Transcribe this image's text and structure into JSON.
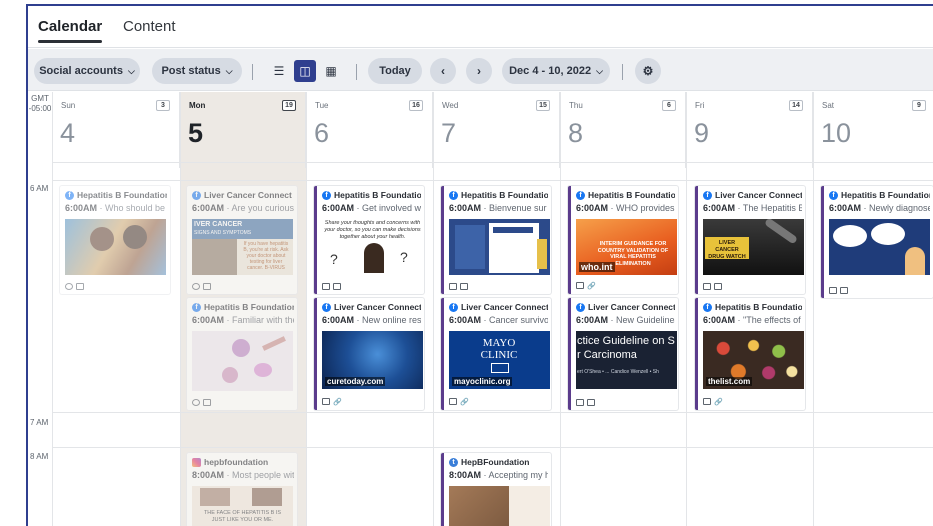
{
  "tabs": [
    {
      "label": "Calendar",
      "active": true
    },
    {
      "label": "Content",
      "active": false
    }
  ],
  "toolbar": {
    "social_accounts": "Social accounts",
    "post_status": "Post status",
    "today": "Today",
    "date_range": "Dec 4 - 10, 2022"
  },
  "timezone": {
    "line1": "GMT",
    "line2": "-05:00"
  },
  "days": [
    {
      "name": "Sun",
      "number": "4",
      "count": "3"
    },
    {
      "name": "Mon",
      "number": "5",
      "count": "19"
    },
    {
      "name": "Tue",
      "number": "6",
      "count": "16"
    },
    {
      "name": "Wed",
      "number": "7",
      "count": "15"
    },
    {
      "name": "Thu",
      "number": "8",
      "count": "6"
    },
    {
      "name": "Fri",
      "number": "9",
      "count": "14"
    },
    {
      "name": "Sat",
      "number": "10",
      "count": "9"
    }
  ],
  "time_labels": [
    "6 AM",
    "7 AM",
    "8 AM"
  ],
  "posts": {
    "sun_6a": {
      "account": "Hepatitis B Foundation",
      "time": "6:00AM",
      "text": " · Who should be vaccinated"
    },
    "mon_6a": {
      "account": "Liver Cancer Connect",
      "time": "6:00AM",
      "text": " · Are you curious",
      "thumb_title": "IVER CANCER",
      "thumb_sub": "SIGNS AND SYMPTOMS",
      "thumb_body": "If you have hepatitis B, you're at risk. Ask your doctor about testing for liver cancer. B-VIRUS"
    },
    "mon_6b": {
      "account": "Hepatitis B Foundation",
      "time": "6:00AM",
      "text": " · Familiar with the"
    },
    "mon_8a": {
      "account": "hepbfoundation",
      "time": "8:00AM",
      "text": " · Most people with",
      "thumb_caption": "THE FACE OF HEPATITIS B IS JUST LIKE YOU OR ME."
    },
    "tue_6a": {
      "account": "Hepatitis B Foundation",
      "time": "6:00AM",
      "text": " · Get involved with",
      "thumb_body": "Share your thoughts and concerns with your doctor, so you can make decisions together about your health."
    },
    "tue_6b": {
      "account": "Liver Cancer Connect",
      "time": "6:00AM",
      "text": " · New online resource",
      "thumb_tag": "curetoday.com"
    },
    "wed_6a": {
      "account": "Hepatitis B Foundation",
      "time": "6:00AM",
      "text": " · Bienvenue sur le"
    },
    "wed_6b": {
      "account": "Liver Cancer Connect",
      "time": "6:00AM",
      "text": " · Cancer survivors",
      "thumb_brand": "MAYO CLINIC",
      "thumb_tag": "mayoclinic.org"
    },
    "wed_8a": {
      "account": "HepBFoundation",
      "time": "8:00AM",
      "text": " · Accepting my hepatitis"
    },
    "thu_6a": {
      "account": "Hepatitis B Foundation",
      "time": "6:00AM",
      "text": " · WHO provides guidance",
      "thumb_body": "INTERIM GUIDANCE FOR COUNTRY VALIDATION OF VIRAL HEPATITIS ELIMINATION",
      "thumb_tag": "who.int"
    },
    "thu_6b": {
      "account": "Liver Cancer Connect",
      "time": "6:00AM",
      "text": " · New Guidelines",
      "thumb_l1": "ctice Guideline on S",
      "thumb_l2": "r Carcinoma",
      "thumb_l3": "ert O'Shea • ... Candice Wenzell • Sh"
    },
    "fri_6a": {
      "account": "Liver Cancer Connect",
      "time": "6:00AM",
      "text": " · The Hepatitis B Foundation",
      "thumb_body": "LIVER CANCER DRUG WATCH"
    },
    "fri_6b": {
      "account": "Hepatitis B Foundation",
      "time": "6:00AM",
      "text": " · \"The effects of a",
      "thumb_tag": "thelist.com"
    },
    "sat_6a": {
      "account": "Hepatitis B Foundation",
      "time": "6:00AM",
      "text": " · Newly diagnosed"
    }
  },
  "colors": {
    "accent": "#2f3f8f",
    "facebook": "#1877f2",
    "post_border": "#5b3c8c",
    "today_bg": "#ede9e4"
  }
}
